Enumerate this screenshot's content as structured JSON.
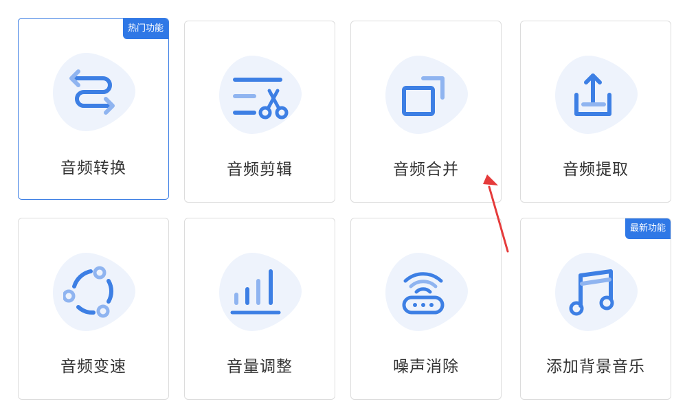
{
  "cards": [
    {
      "label": "音频转换",
      "badge": "热门功能",
      "icon": "convert-arrows-icon"
    },
    {
      "label": "音频剪辑",
      "badge": "",
      "icon": "scissors-icon"
    },
    {
      "label": "音频合并",
      "badge": "",
      "icon": "merge-squares-icon"
    },
    {
      "label": "音频提取",
      "badge": "",
      "icon": "upload-tray-icon"
    },
    {
      "label": "音频变速",
      "badge": "",
      "icon": "speed-circle-icon"
    },
    {
      "label": "音量调整",
      "badge": "",
      "icon": "volume-bars-icon"
    },
    {
      "label": "噪声消除",
      "badge": "",
      "icon": "noise-wave-icon"
    },
    {
      "label": "添加背景音乐",
      "badge": "最新功能",
      "icon": "music-note-icon"
    }
  ],
  "colors": {
    "accent": "#3d7fe4",
    "icon_light": "#8fb4f0",
    "blob": "#eef3fc",
    "arrow": "#e53b3b"
  }
}
